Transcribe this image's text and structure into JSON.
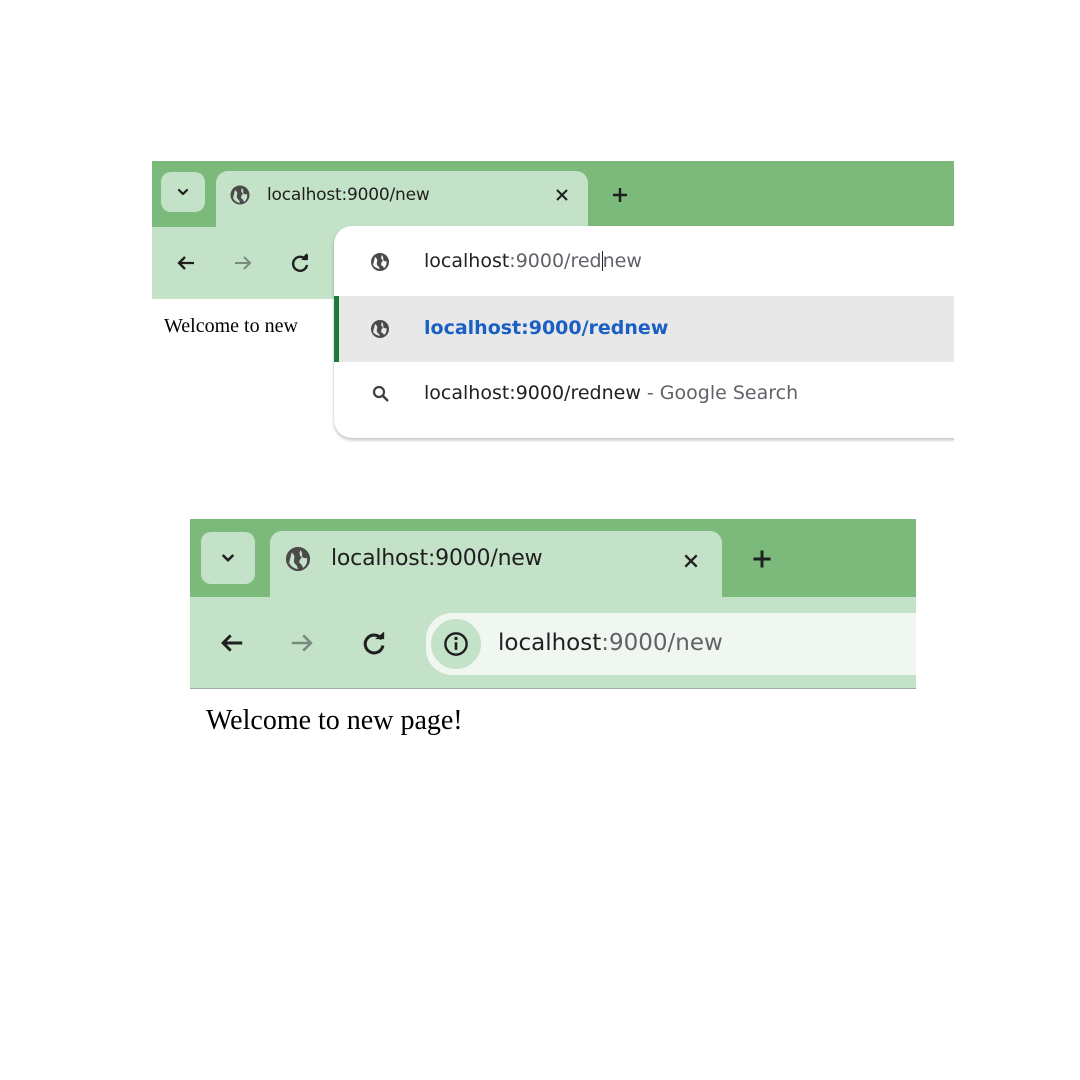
{
  "top_screenshot": {
    "tab": {
      "title": "localhost:9000/new"
    },
    "omnibox": {
      "input_before_caret": "localhost",
      "input_dim_before_caret": ":9000/red",
      "input_after_caret": "new"
    },
    "suggestions": [
      {
        "text": "localhost:9000/rednew",
        "suffix": "",
        "icon": "globe-icon",
        "selected": true
      },
      {
        "text": "localhost:9000/rednew",
        "suffix": " - Google Search",
        "icon": "search-icon",
        "selected": false
      }
    ],
    "page_text": "Welcome to new"
  },
  "bottom_screenshot": {
    "tab": {
      "title": "localhost:9000/new"
    },
    "address": {
      "host": "localhost",
      "rest": ":9000/new"
    },
    "page_text": "Welcome to new page!"
  },
  "colors": {
    "tabstrip": "#7cba7c",
    "toolbar": "#c3e2c7",
    "accent_bar": "#1e7a36",
    "link_blue": "#1a5fc4"
  }
}
